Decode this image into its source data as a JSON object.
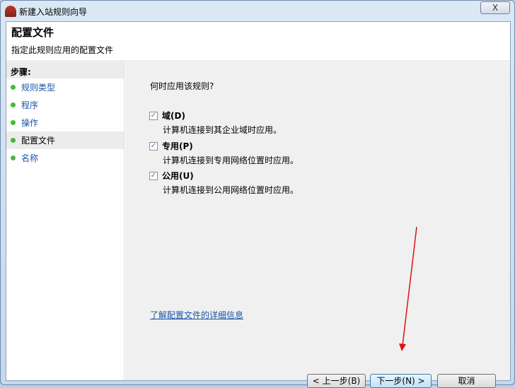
{
  "window": {
    "title": "新建入站规则向导",
    "close": "X"
  },
  "header": {
    "title": "配置文件",
    "subtitle": "指定此规则应用的配置文件"
  },
  "sidebar": {
    "heading": "步骤:",
    "items": [
      {
        "label": "规则类型"
      },
      {
        "label": "程序"
      },
      {
        "label": "操作"
      },
      {
        "label": "配置文件",
        "active": true
      },
      {
        "label": "名称"
      }
    ]
  },
  "main": {
    "question": "何时应用该规则?",
    "options": [
      {
        "label": "域(D)",
        "checked": true,
        "desc": "计算机连接到其企业域时应用。"
      },
      {
        "label": "专用(P)",
        "checked": true,
        "desc": "计算机连接到专用网络位置时应用。"
      },
      {
        "label": "公用(U)",
        "checked": true,
        "desc": "计算机连接到公用网络位置时应用。"
      }
    ],
    "link": "了解配置文件的详细信息"
  },
  "buttons": {
    "back": "< 上一步(B)",
    "next": "下一步(N) >",
    "cancel": "取消"
  },
  "check_glyph": "✓"
}
